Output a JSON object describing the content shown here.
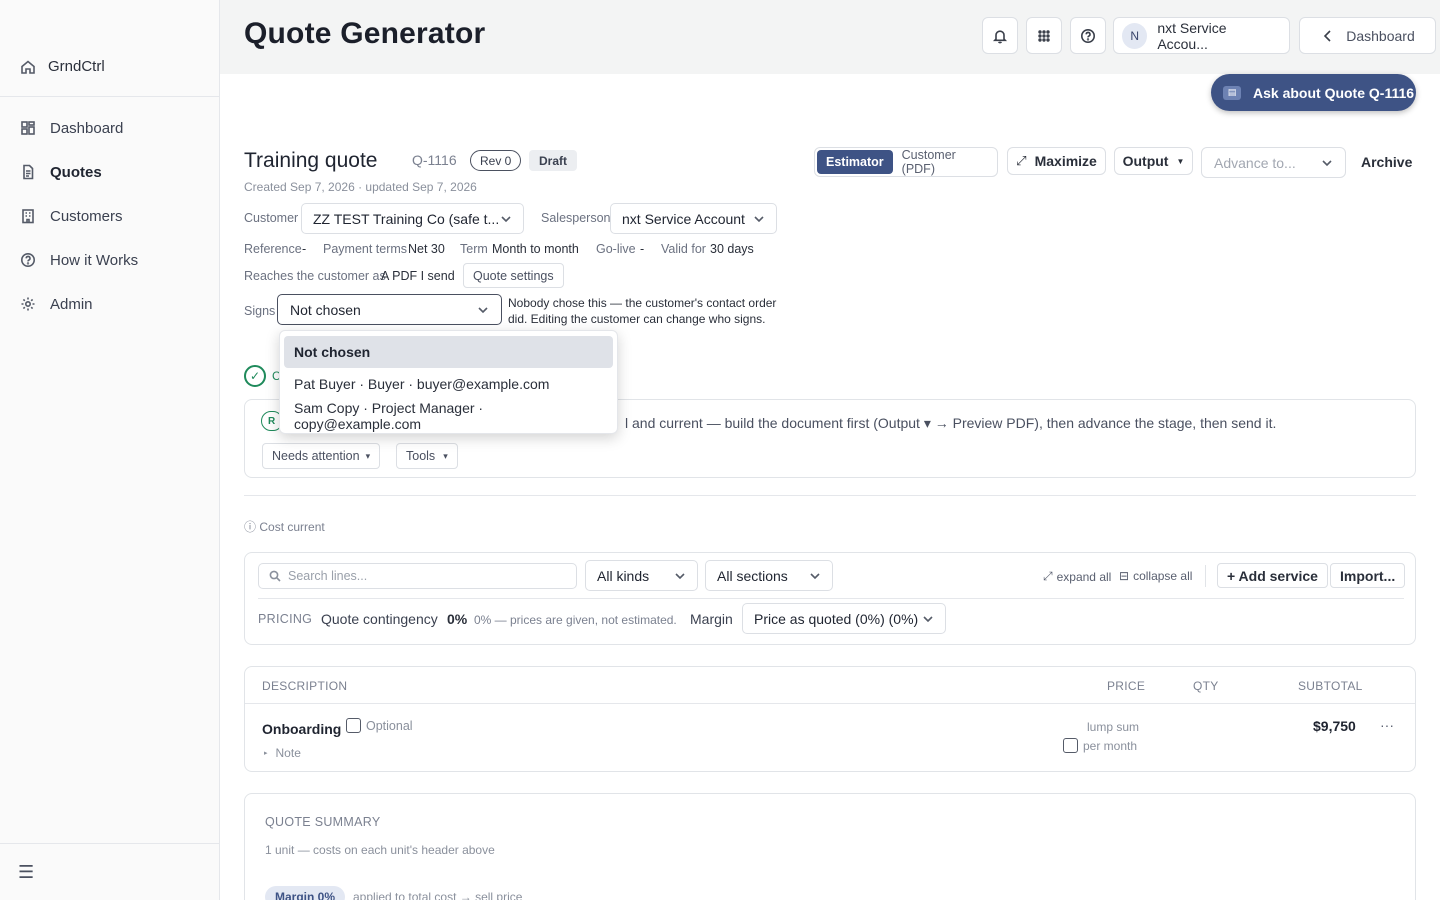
{
  "sidebar": {
    "brand": "GrndCtrl",
    "items": [
      {
        "label": "Dashboard"
      },
      {
        "label": "Quotes"
      },
      {
        "label": "Customers"
      },
      {
        "label": "How it Works"
      },
      {
        "label": "Admin"
      }
    ],
    "menu_icon": "☰"
  },
  "header": {
    "title": "Quote Generator",
    "account_initial": "N",
    "account_name": "nxt Service Accou...",
    "dashboard_label": "Dashboard"
  },
  "assistant": {
    "ask_label": "Ask about Quote Q-1116"
  },
  "quote": {
    "title": "Training quote",
    "id": "Q-1116",
    "rev": "Rev 0",
    "status": "Draft",
    "created": "Created Sep 7, 2026 · updated Sep 7, 2026",
    "view_estimator": "Estimator",
    "view_customer": "Customer (PDF)",
    "maximize": "Maximize",
    "output": "Output",
    "advance_placeholder": "Advance to...",
    "archive": "Archive",
    "customer_label": "Customer",
    "customer_value": "ZZ TEST Training Co (safe t...",
    "salesperson_label": "Salesperson",
    "salesperson_value": "nxt Service Account",
    "reference_label": "Reference",
    "reference_value": "-",
    "payment_label": "Payment terms",
    "payment_value": "Net 30",
    "term_label": "Term",
    "term_value": "Month to month",
    "golive_label": "Go-live",
    "golive_value": "-",
    "valid_label": "Valid for",
    "valid_value": "30 days",
    "reaches_label": "Reaches the customer as",
    "reaches_value": "A PDF I send",
    "settings_label": "Quote settings",
    "signs_label": "Signs",
    "signs_value": "Not chosen",
    "signs_help": "Nobody chose this — the customer's contact order did. Editing the customer can change who signs."
  },
  "signs_dropdown": {
    "options": [
      "Not chosen",
      "Pat Buyer · Buyer · buyer@example.com",
      "Sam Copy · Project Manager · copy@example.com"
    ],
    "selected": "Not chosen"
  },
  "readiness": {
    "pill": "R",
    "check_letter": "C",
    "text": "l and current — build the document first (Output ▾ → Preview PDF), then advance the stage, then send it.",
    "needs_attention": "Needs attention",
    "tools": "Tools"
  },
  "cost_current": "Cost current",
  "lines": {
    "search_placeholder": "Search lines...",
    "kinds": "All kinds",
    "sections": "All sections",
    "expand_all": "expand all",
    "collapse_all": "collapse all",
    "add_service": "+ Add service",
    "import": "Import...",
    "pricing_label": "PRICING",
    "contingency_label": "Quote contingency",
    "contingency_value": "0%",
    "contingency_note": "0% — prices are given, not estimated.",
    "margin_label": "Margin",
    "margin_value": "Price as quoted (0%) (0%)"
  },
  "table": {
    "headers": {
      "description": "DESCRIPTION",
      "price": "PRICE",
      "qty": "QTY",
      "subtotal": "SUBTOTAL"
    },
    "row": {
      "name": "Onboarding",
      "optional": "Optional",
      "note": "Note",
      "price_type": "lump sum",
      "per_month": "per month",
      "subtotal": "$9,750",
      "more": "···"
    }
  },
  "summary": {
    "title": "QUOTE SUMMARY",
    "units": "1 unit — costs on each unit's header above",
    "margin_pill": "Margin 0%",
    "margin_note": "applied to total cost → sell price"
  }
}
